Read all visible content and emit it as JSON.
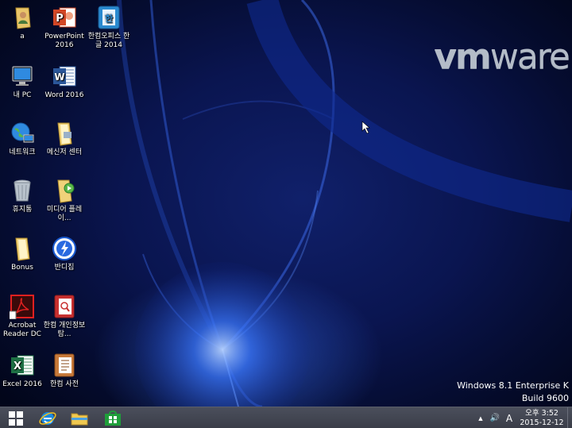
{
  "desktop": {
    "icons": [
      {
        "label": "a"
      },
      {
        "label": "PowerPoint 2016"
      },
      {
        "label": "한컴오피스 한글 2014"
      },
      {
        "label": "내 PC"
      },
      {
        "label": "Word 2016"
      },
      {
        "label": "네트워크"
      },
      {
        "label": "메신저 센터"
      },
      {
        "label": "휴지통"
      },
      {
        "label": "미디어 플레이..."
      },
      {
        "label": "Bonus"
      },
      {
        "label": "반디집"
      },
      {
        "label": "Acrobat Reader DC"
      },
      {
        "label": "한컴 개인정보탐..."
      },
      {
        "label": "Excel 2016"
      },
      {
        "label": "한컴 사전"
      }
    ]
  },
  "wallpaper": {
    "brand_vm": "vm",
    "brand_ware": "ware",
    "os_name": "Windows 8.1 Enterprise K",
    "os_build": "Build 9600"
  },
  "taskbar": {
    "pinned": [
      "start-button",
      "internet-explorer-icon",
      "file-explorer-icon",
      "store-icon"
    ],
    "tray": {
      "show_hidden": "▲",
      "volume": "🔊",
      "ime": "A",
      "time": "오후 3:52",
      "date": "2015-12-12"
    }
  },
  "colors": {
    "taskbar": "#3f424e",
    "wallpaper_dark": "#050c30",
    "wallpaper_glow": "#3c78ff"
  }
}
